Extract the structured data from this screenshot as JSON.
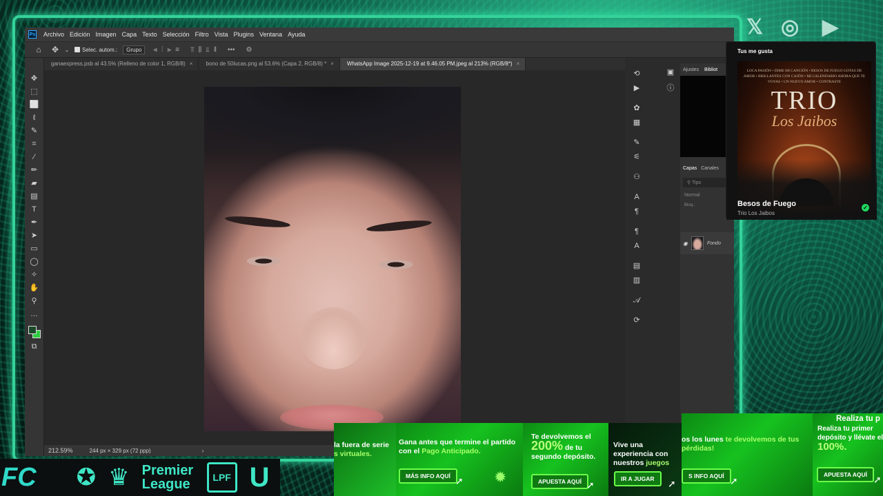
{
  "social": [
    "𝕏",
    "◎",
    "▶"
  ],
  "menu": [
    "Archivo",
    "Edición",
    "Imagen",
    "Capa",
    "Texto",
    "Selección",
    "Filtro",
    "Vista",
    "Plugins",
    "Ventana",
    "Ayuda"
  ],
  "ps_logo": "Ps",
  "options": {
    "auto_select_label": "Selec. autom.:",
    "auto_select_value": "Grupo"
  },
  "tabs": [
    {
      "label": "ganaexpress.psb al 43.5% (Relleno de color 1, RGB/8)",
      "active": false
    },
    {
      "label": "bono de 50lucas.png al 53.6% (Capa 2, RGB/8) *",
      "active": false
    },
    {
      "label": "WhatsApp Image 2025-12-19 at 9.46.05 PM.jpeg al 213% (RGB/8*)",
      "active": true
    }
  ],
  "status": {
    "zoom": "212.59%",
    "doc_info": "244 px × 329 px (72 ppp)",
    "arrow": "›"
  },
  "panels": {
    "top_tabs": [
      "Ajustes",
      "Bibliot"
    ],
    "layer_tabs": [
      "Capas",
      "Canales"
    ],
    "search_placeholder": "Tipo",
    "blend_mode": "Normal",
    "lock_label": "Bloq.:",
    "layer_name": "Fondo"
  },
  "spotify": {
    "header": "Tus me gusta",
    "album_lines": "LOCA PASIÓN • DIME MI CANCIÓN • BESOS DE FUEGO GOTAS DE AMOR • BRILLANTES CON CAJÓN • MI CALENDARIO AHORA QUE TE VOYAS • UN NUEVO AMOR • CONTRASTE",
    "album_title": "TRIO",
    "album_subtitle": "Los Jaibos",
    "song": "Besos de Fuego",
    "artist": "Trio Los Jaibos",
    "accent": "#1ed760"
  },
  "logos": {
    "fc": "FC",
    "premier": "Premier League",
    "lpf": "LPF",
    "u": "U"
  },
  "banners": {
    "b1_text": "la fuera de serie",
    "b1_hl": "s virtuales.",
    "b2_text1": "Gana antes que termine el partido con el",
    "b2_hl": "Pago Anticipado.",
    "b2_btn": "MÁS INFO AQUÍ",
    "b3_text1": "Te devolvemos el",
    "b3_big": "200%",
    "b3_text2": "de tu segundo depósito.",
    "b3_btn": "APUESTA AQUÍ",
    "b4_text1": "Vive una experiencia con nuestros",
    "b4_hl": "juegos",
    "b4_btn": "IR A JUGAR",
    "b5_text1": "os los lunes",
    "b5_hl": "te devolvemos de tus pérdidas!",
    "b5_btn": "S INFO AQUÍ",
    "b6_title": "Realiza tu p",
    "b6_text": "Realiza tu primer depósito y llévate el",
    "b6_big": "100%.",
    "b6_btn": "APUESTA AQUÍ"
  },
  "colors": {
    "frame": "#35d39a",
    "ps_bg": "#282828",
    "banner_green": "#16c21f"
  }
}
